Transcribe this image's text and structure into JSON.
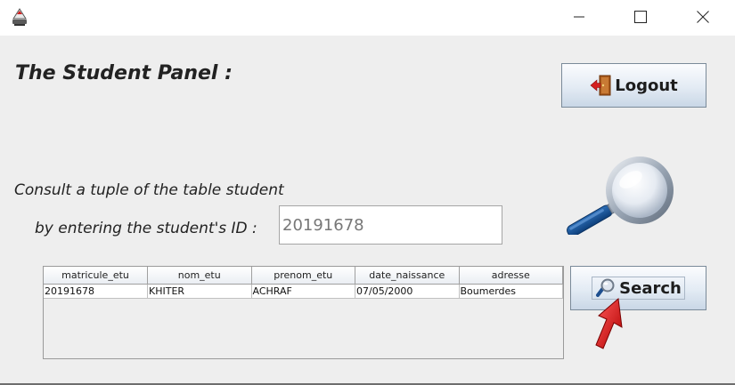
{
  "titlebar": {
    "app_icon": "java-cup-icon",
    "minimize_icon": "minimize-icon",
    "maximize_icon": "maximize-icon",
    "close_icon": "close-icon"
  },
  "panel": {
    "title": "The Student Panel :",
    "consult_text": "Consult a tuple of the table student",
    "id_label": "by entering the student's ID :",
    "id_value": "20191678"
  },
  "buttons": {
    "logout": {
      "label": "Logout",
      "icon": "door-exit-icon"
    },
    "search": {
      "label": "Search",
      "icon": "magnifier-icon"
    }
  },
  "decor": {
    "large_icon": "magnifying-glass-icon",
    "arrow_icon": "red-arrow-icon"
  },
  "table": {
    "columns": [
      "matricule_etu",
      "nom_etu",
      "prenom_etu",
      "date_naissance",
      "adresse"
    ],
    "rows": [
      [
        "20191678",
        "KHITER",
        "ACHRAF",
        "07/05/2000",
        "Boumerdes"
      ]
    ]
  }
}
